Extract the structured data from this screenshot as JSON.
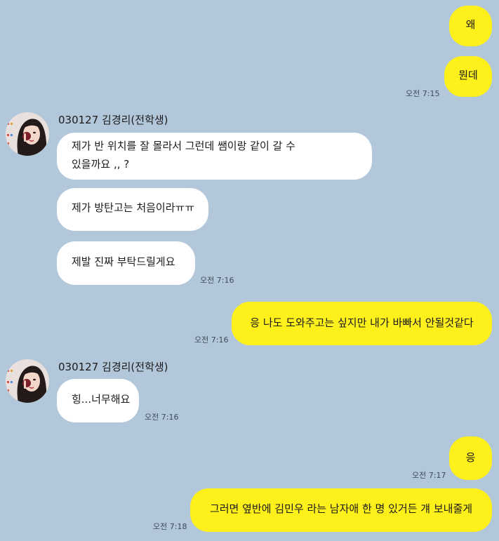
{
  "messages_out_1": {
    "text": "왜"
  },
  "messages_out_2": {
    "text": "뭔데",
    "time": "오전 7:15"
  },
  "group_1": {
    "sender": "030127 김경리(전학생)",
    "msg1_line1": "제가 반 위치를 잘 몰라서 그런데 쌤이랑 같이 갈 수",
    "msg1_line2": "있을까요 ,, ?",
    "msg2": "제가 방탄고는 처음이라ㅠㅠ",
    "msg3": "제발 진짜 부탁드릴게요",
    "time": "오전 7:16"
  },
  "messages_out_3": {
    "text": "응 나도 도와주고는 싶지만 내가 바빠서 안될것같다",
    "time": "오전 7:16"
  },
  "group_2": {
    "sender": "030127 김경리(전학생)",
    "msg1": "힝...너무해요",
    "time": "오전 7:16"
  },
  "messages_out_4": {
    "text": "응",
    "time": "오전 7:17"
  },
  "messages_out_5": {
    "text": "그러면 옆반에 김민우 라는 남자애 한 명 있거든 걔 보내줄게",
    "time": "오전 7:18"
  },
  "colors": {
    "background": "#b2c7da",
    "my_bubble": "#fef01b",
    "other_bubble": "#ffffff"
  },
  "icons": {
    "avatar": "profile-photo-avatar"
  }
}
